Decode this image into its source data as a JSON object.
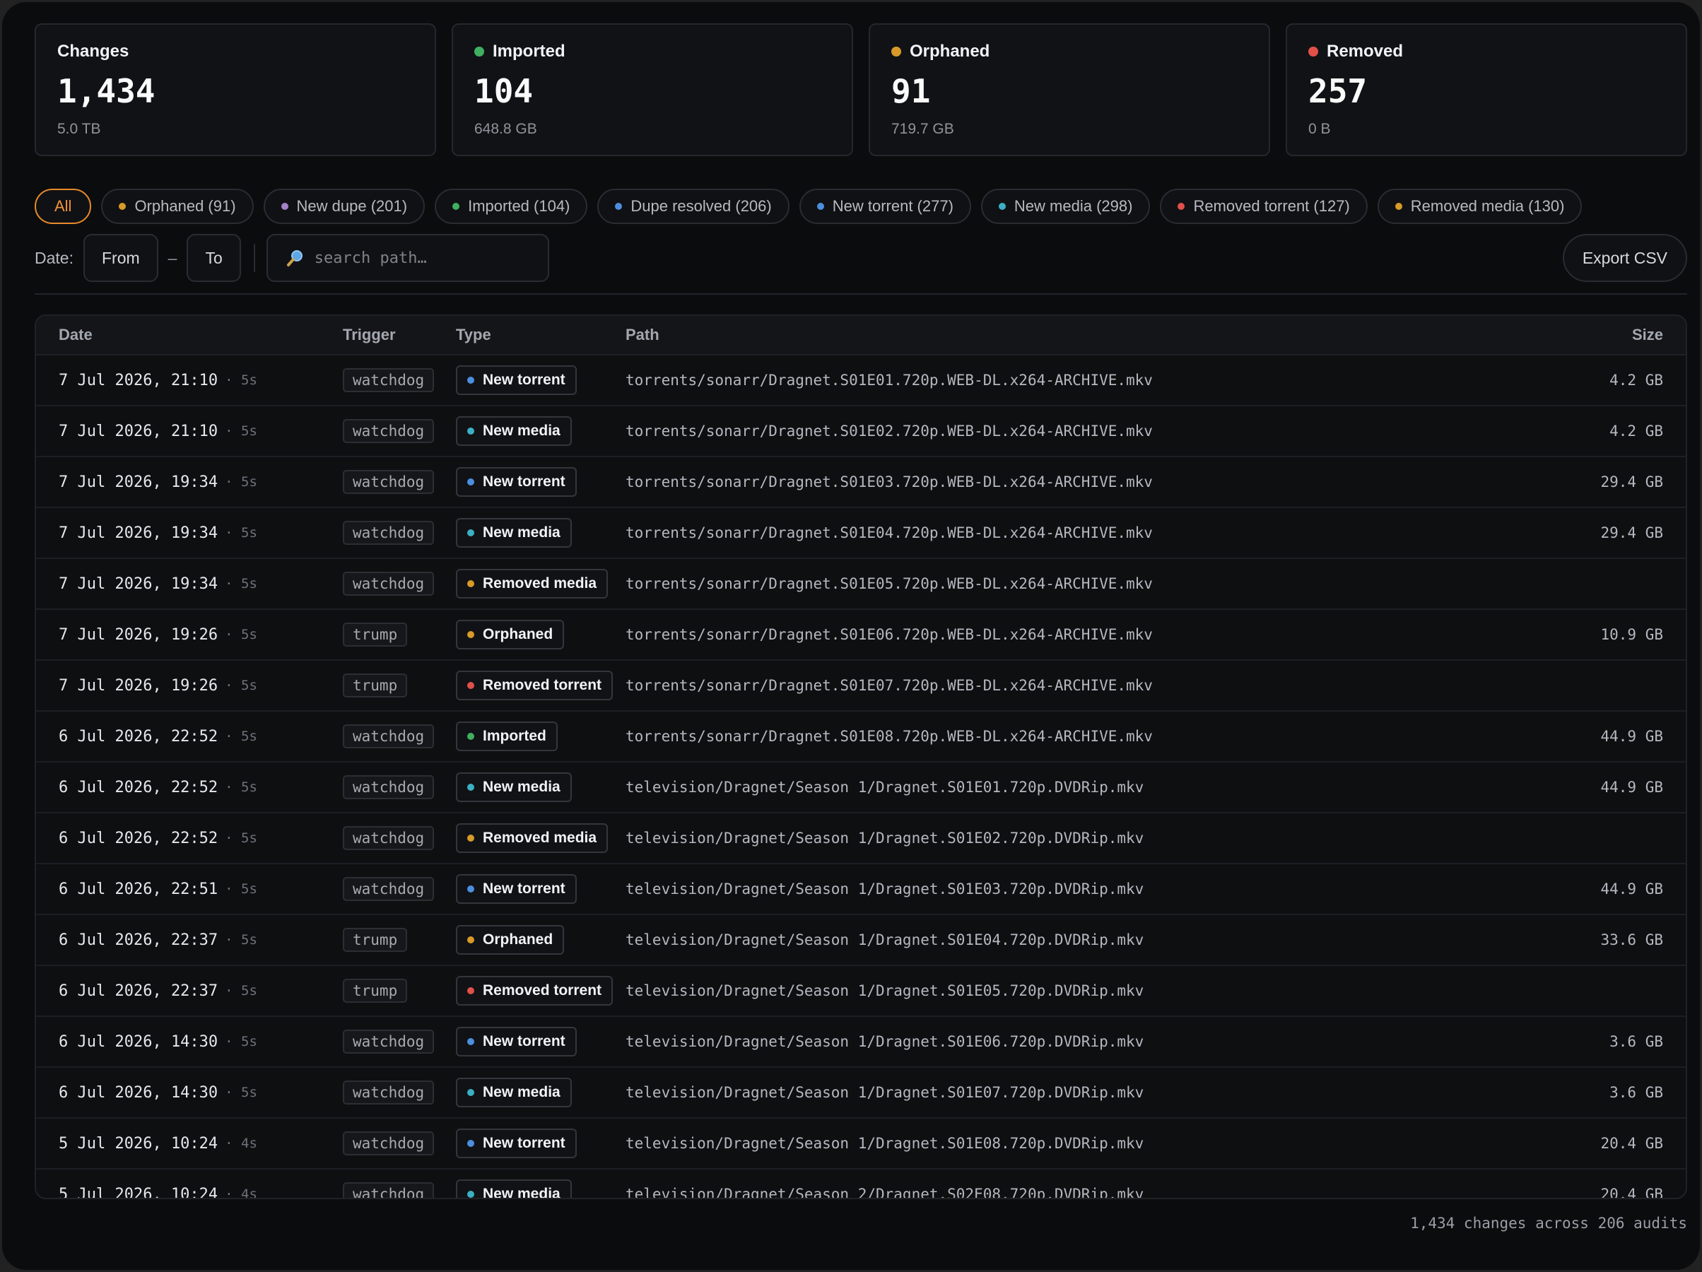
{
  "colors": {
    "imported": "#3fb060",
    "orphaned": "#d89a28",
    "removed": "#e2504a",
    "new_dupe": "#a482c8",
    "dupe_resolved": "#4c8ee0",
    "new_torrent": "#4c8ee0",
    "new_media": "#3bb0c4",
    "removed_torrent": "#e2504a",
    "removed_media": "#d89a28",
    "accent": "#e88a2a"
  },
  "stats": [
    {
      "title": "Changes",
      "value": "1,434",
      "sub": "5.0 TB",
      "color": ""
    },
    {
      "title": "Imported",
      "value": "104",
      "sub": "648.8 GB",
      "color": "#3fb060"
    },
    {
      "title": "Orphaned",
      "value": "91",
      "sub": "719.7 GB",
      "color": "#d89a28"
    },
    {
      "title": "Removed",
      "value": "257",
      "sub": "0 B",
      "color": "#e2504a"
    }
  ],
  "filters": [
    {
      "label": "All",
      "color": "",
      "active": true
    },
    {
      "label": "Orphaned (91)",
      "color": "#d89a28"
    },
    {
      "label": "New dupe (201)",
      "color": "#a482c8"
    },
    {
      "label": "Imported (104)",
      "color": "#3fb060"
    },
    {
      "label": "Dupe resolved (206)",
      "color": "#4c8ee0"
    },
    {
      "label": "New torrent (277)",
      "color": "#4c8ee0"
    },
    {
      "label": "New media (298)",
      "color": "#3bb0c4"
    },
    {
      "label": "Removed torrent (127)",
      "color": "#e2504a"
    },
    {
      "label": "Removed media (130)",
      "color": "#d89a28"
    }
  ],
  "toolbar": {
    "date_label": "Date:",
    "from": "From",
    "dash": "–",
    "to": "To",
    "search_placeholder": "search path…",
    "search_icon": "magnifier-icon",
    "export": "Export CSV"
  },
  "table": {
    "headers": {
      "date": "Date",
      "trigger": "Trigger",
      "type": "Type",
      "path": "Path",
      "size": "Size"
    },
    "rows": [
      {
        "date": "7 Jul 2026, 21:10",
        "ago": "· 5s",
        "trigger": "watchdog",
        "type": "New torrent",
        "color": "#4c8ee0",
        "path": "torrents/sonarr/Dragnet.S01E01.720p.WEB-DL.x264-ARCHIVE.mkv",
        "size": "4.2 GB"
      },
      {
        "date": "7 Jul 2026, 21:10",
        "ago": "· 5s",
        "trigger": "watchdog",
        "type": "New media",
        "color": "#3bb0c4",
        "path": "torrents/sonarr/Dragnet.S01E02.720p.WEB-DL.x264-ARCHIVE.mkv",
        "size": "4.2 GB"
      },
      {
        "date": "7 Jul 2026, 19:34",
        "ago": "· 5s",
        "trigger": "watchdog",
        "type": "New torrent",
        "color": "#4c8ee0",
        "path": "torrents/sonarr/Dragnet.S01E03.720p.WEB-DL.x264-ARCHIVE.mkv",
        "size": "29.4 GB"
      },
      {
        "date": "7 Jul 2026, 19:34",
        "ago": "· 5s",
        "trigger": "watchdog",
        "type": "New media",
        "color": "#3bb0c4",
        "path": "torrents/sonarr/Dragnet.S01E04.720p.WEB-DL.x264-ARCHIVE.mkv",
        "size": "29.4 GB"
      },
      {
        "date": "7 Jul 2026, 19:34",
        "ago": "· 5s",
        "trigger": "watchdog",
        "type": "Removed media",
        "color": "#d89a28",
        "path": "torrents/sonarr/Dragnet.S01E05.720p.WEB-DL.x264-ARCHIVE.mkv",
        "size": ""
      },
      {
        "date": "7 Jul 2026, 19:26",
        "ago": "· 5s",
        "trigger": "trump",
        "type": "Orphaned",
        "color": "#d89a28",
        "path": "torrents/sonarr/Dragnet.S01E06.720p.WEB-DL.x264-ARCHIVE.mkv",
        "size": "10.9 GB"
      },
      {
        "date": "7 Jul 2026, 19:26",
        "ago": "· 5s",
        "trigger": "trump",
        "type": "Removed torrent",
        "color": "#e2504a",
        "path": "torrents/sonarr/Dragnet.S01E07.720p.WEB-DL.x264-ARCHIVE.mkv",
        "size": ""
      },
      {
        "date": "6 Jul 2026, 22:52",
        "ago": "· 5s",
        "trigger": "watchdog",
        "type": "Imported",
        "color": "#3fb060",
        "path": "torrents/sonarr/Dragnet.S01E08.720p.WEB-DL.x264-ARCHIVE.mkv",
        "size": "44.9 GB"
      },
      {
        "date": "6 Jul 2026, 22:52",
        "ago": "· 5s",
        "trigger": "watchdog",
        "type": "New media",
        "color": "#3bb0c4",
        "path": "television/Dragnet/Season 1/Dragnet.S01E01.720p.DVDRip.mkv",
        "size": "44.9 GB"
      },
      {
        "date": "6 Jul 2026, 22:52",
        "ago": "· 5s",
        "trigger": "watchdog",
        "type": "Removed media",
        "color": "#d89a28",
        "path": "television/Dragnet/Season 1/Dragnet.S01E02.720p.DVDRip.mkv",
        "size": ""
      },
      {
        "date": "6 Jul 2026, 22:51",
        "ago": "· 5s",
        "trigger": "watchdog",
        "type": "New torrent",
        "color": "#4c8ee0",
        "path": "television/Dragnet/Season 1/Dragnet.S01E03.720p.DVDRip.mkv",
        "size": "44.9 GB"
      },
      {
        "date": "6 Jul 2026, 22:37",
        "ago": "· 5s",
        "trigger": "trump",
        "type": "Orphaned",
        "color": "#d89a28",
        "path": "television/Dragnet/Season 1/Dragnet.S01E04.720p.DVDRip.mkv",
        "size": "33.6 GB"
      },
      {
        "date": "6 Jul 2026, 22:37",
        "ago": "· 5s",
        "trigger": "trump",
        "type": "Removed torrent",
        "color": "#e2504a",
        "path": "television/Dragnet/Season 1/Dragnet.S01E05.720p.DVDRip.mkv",
        "size": ""
      },
      {
        "date": "6 Jul 2026, 14:30",
        "ago": "· 5s",
        "trigger": "watchdog",
        "type": "New torrent",
        "color": "#4c8ee0",
        "path": "television/Dragnet/Season 1/Dragnet.S01E06.720p.DVDRip.mkv",
        "size": "3.6 GB"
      },
      {
        "date": "6 Jul 2026, 14:30",
        "ago": "· 5s",
        "trigger": "watchdog",
        "type": "New media",
        "color": "#3bb0c4",
        "path": "television/Dragnet/Season 1/Dragnet.S01E07.720p.DVDRip.mkv",
        "size": "3.6 GB"
      },
      {
        "date": "5 Jul 2026, 10:24",
        "ago": "· 4s",
        "trigger": "watchdog",
        "type": "New torrent",
        "color": "#4c8ee0",
        "path": "television/Dragnet/Season 1/Dragnet.S01E08.720p.DVDRip.mkv",
        "size": "20.4 GB"
      },
      {
        "date": "5 Jul 2026, 10:24",
        "ago": "· 4s",
        "trigger": "watchdog",
        "type": "New media",
        "color": "#3bb0c4",
        "path": "television/Dragnet/Season 2/Dragnet.S02E08.720p.DVDRip.mkv",
        "size": "20.4 GB"
      }
    ]
  },
  "footer": "1,434 changes across 206 audits"
}
